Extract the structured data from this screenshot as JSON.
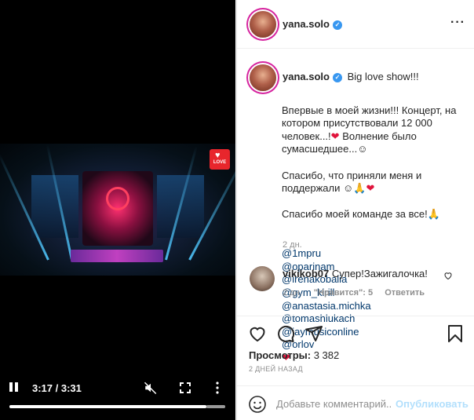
{
  "video": {
    "current_time": "3:17",
    "duration": "3:31",
    "time_display": "3:17 / 3:31",
    "progress_fraction": 0.912,
    "logo_label": "LOVE"
  },
  "post": {
    "author": "yana.solo",
    "verified": true,
    "caption_title": "Big love show!!!",
    "caption_lines": [
      "Впервые в моей жизни!!! Концерт, на котором присутствовали 12 000 человек...!",
      "Волнение было сумасшедшее...☺",
      "Спасибо, что приняли меня и поддержали ☺🙏",
      "Спасибо моей команде за все!🙏"
    ],
    "mentions": [
      "@1mpru",
      "@oparinam",
      "@irenakobalia",
      "@gym_kirill",
      "@anastasia.michka",
      "@tomashlukach",
      "@jaymusiconline",
      "@orlov"
    ],
    "caption_age": "2 дн."
  },
  "comment": {
    "author": "vikikob07",
    "text": "Супер!Зажигалочка!",
    "age": "2 дн.",
    "likes_label": "\"Нравится\": 5",
    "reply_label": "Ответить"
  },
  "stats": {
    "views_label": "Просмотры:",
    "views_count": "3 382",
    "date": "2 ДНЕЙ НАЗАД"
  },
  "composer": {
    "placeholder": "Добавьте комментарий...",
    "publish_label": "Опубликовать"
  },
  "colors": {
    "link": "#00376b",
    "verified": "#3897f0",
    "heart": "#e0143c",
    "publish_disabled": "#b2dffc"
  }
}
